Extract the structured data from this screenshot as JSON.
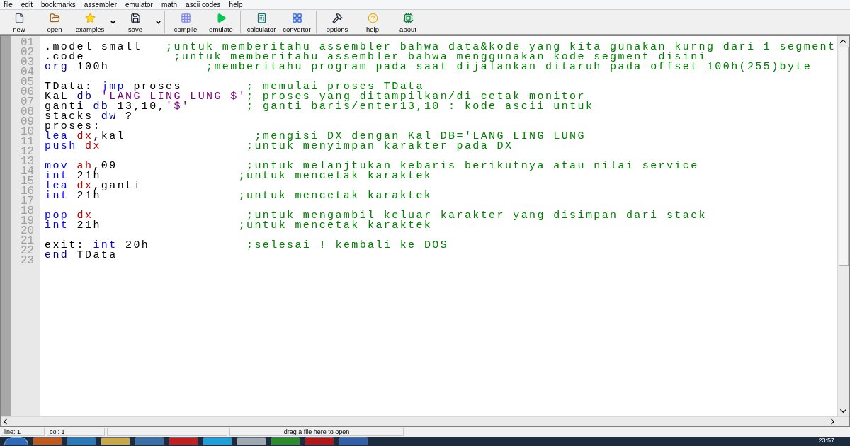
{
  "menu": [
    "file",
    "edit",
    "bookmarks",
    "assembler",
    "emulator",
    "math",
    "ascii codes",
    "help"
  ],
  "toolbar": [
    [
      {
        "label": "new",
        "dropdown": false
      },
      {
        "label": "open",
        "dropdown": false
      },
      {
        "label": "examples",
        "dropdown": true
      },
      {
        "label": "save",
        "dropdown": true
      }
    ],
    [
      {
        "label": "compile",
        "dropdown": false
      },
      {
        "label": "emulate",
        "dropdown": false
      }
    ],
    [
      {
        "label": "calculator",
        "dropdown": false
      },
      {
        "label": "convertor",
        "dropdown": false
      }
    ],
    [
      {
        "label": "options",
        "dropdown": false
      },
      {
        "label": "help",
        "dropdown": false
      },
      {
        "label": "about",
        "dropdown": false
      }
    ]
  ],
  "editor": {
    "lines": [
      {
        "number": "01",
        "tokens": [
          {
            "kind": "plain",
            "text": ".model small   "
          },
          {
            "kind": "comment",
            "text": ";untuk memberitahu assembler bahwa data&kode yang kita gunakan kurng dari 1 segment"
          }
        ]
      },
      {
        "number": "02",
        "tokens": [
          {
            "kind": "plain",
            "text": ".code           "
          },
          {
            "kind": "comment",
            "text": ";untuk memberitahu assembler bahwa menggunakan kode segment disini"
          }
        ]
      },
      {
        "number": "03",
        "tokens": [
          {
            "kind": "directive",
            "text": "org "
          },
          {
            "kind": "plain",
            "text": "100h            "
          },
          {
            "kind": "comment",
            "text": ";memberitahu program pada saat dijalankan ditaruh pada offset 100h(255)byte"
          }
        ]
      },
      {
        "number": "04"
      },
      {
        "number": "05",
        "tokens": [
          {
            "kind": "plain",
            "text": "TData: "
          },
          {
            "kind": "keyword",
            "text": "jmp "
          },
          {
            "kind": "plain",
            "text": "proses        "
          },
          {
            "kind": "comment",
            "text": "; memulai proses TData"
          }
        ]
      },
      {
        "number": "06",
        "tokens": [
          {
            "kind": "plain",
            "text": "KaL "
          },
          {
            "kind": "directive",
            "text": "db "
          },
          {
            "kind": "string",
            "text": "'LANG LING LUNG $'"
          },
          {
            "kind": "comment",
            "text": "; proses yang ditampilkan/di cetak monitor"
          }
        ]
      },
      {
        "number": "07",
        "tokens": [
          {
            "kind": "plain",
            "text": "ganti "
          },
          {
            "kind": "directive",
            "text": "db "
          },
          {
            "kind": "plain",
            "text": "13,10,"
          },
          {
            "kind": "string",
            "text": "'$'       "
          },
          {
            "kind": "comment",
            "text": "; ganti baris/enter13,10 : kode ascii untuk"
          }
        ]
      },
      {
        "number": "08",
        "tokens": [
          {
            "kind": "plain",
            "text": "stacks "
          },
          {
            "kind": "directive",
            "text": "dw "
          },
          {
            "kind": "plain",
            "text": "?"
          }
        ]
      },
      {
        "number": "09",
        "tokens": [
          {
            "kind": "plain",
            "text": "proses:"
          }
        ]
      },
      {
        "number": "10",
        "tokens": [
          {
            "kind": "keyword",
            "text": "lea "
          },
          {
            "kind": "register",
            "text": "dx"
          },
          {
            "kind": "plain",
            "text": ",kal                "
          },
          {
            "kind": "comment",
            "text": ";mengisi DX dengan Kal DB='LANG LING LUNG"
          }
        ]
      },
      {
        "number": "11",
        "tokens": [
          {
            "kind": "keyword",
            "text": "push "
          },
          {
            "kind": "register",
            "text": "dx                  "
          },
          {
            "kind": "comment",
            "text": ";untuk menyimpan karakter pada DX"
          }
        ]
      },
      {
        "number": "12"
      },
      {
        "number": "13",
        "tokens": [
          {
            "kind": "keyword",
            "text": "mov "
          },
          {
            "kind": "register",
            "text": "ah"
          },
          {
            "kind": "plain",
            "text": ",09                "
          },
          {
            "kind": "comment",
            "text": ";untuk melanjtukan kebaris berikutnya atau nilai service"
          }
        ]
      },
      {
        "number": "14",
        "tokens": [
          {
            "kind": "keyword",
            "text": "int "
          },
          {
            "kind": "plain",
            "text": "21h                 "
          },
          {
            "kind": "comment",
            "text": ";untuk mencetak karaktek"
          }
        ]
      },
      {
        "number": "15",
        "tokens": [
          {
            "kind": "keyword",
            "text": "lea "
          },
          {
            "kind": "register",
            "text": "dx"
          },
          {
            "kind": "plain",
            "text": ",ganti"
          }
        ]
      },
      {
        "number": "16",
        "tokens": [
          {
            "kind": "keyword",
            "text": "int "
          },
          {
            "kind": "plain",
            "text": "21h                 "
          },
          {
            "kind": "comment",
            "text": ";untuk mencetak karaktek"
          }
        ]
      },
      {
        "number": "17"
      },
      {
        "number": "18",
        "tokens": [
          {
            "kind": "keyword",
            "text": "pop "
          },
          {
            "kind": "register",
            "text": "dx                   "
          },
          {
            "kind": "comment",
            "text": ";untuk mengambil keluar karakter yang disimpan dari stack"
          }
        ]
      },
      {
        "number": "19",
        "tokens": [
          {
            "kind": "keyword",
            "text": "int "
          },
          {
            "kind": "plain",
            "text": "21h                 "
          },
          {
            "kind": "comment",
            "text": ";untuk mencetak karaktek"
          }
        ]
      },
      {
        "number": "20"
      },
      {
        "number": "21",
        "tokens": [
          {
            "kind": "plain",
            "text": "exit: "
          },
          {
            "kind": "keyword",
            "text": "int "
          },
          {
            "kind": "plain",
            "text": "20h            "
          },
          {
            "kind": "comment",
            "text": ";selesai ! kembali ke DOS"
          }
        ]
      },
      {
        "number": "22",
        "tokens": [
          {
            "kind": "directive",
            "text": "end "
          },
          {
            "kind": "plain",
            "text": "TData"
          }
        ]
      },
      {
        "number": "23"
      }
    ]
  },
  "status_bar": {
    "line": "line: 1",
    "col": "col: 1",
    "hint": "drag a file here to open"
  },
  "taskbar": {
    "clock": "23:57"
  }
}
